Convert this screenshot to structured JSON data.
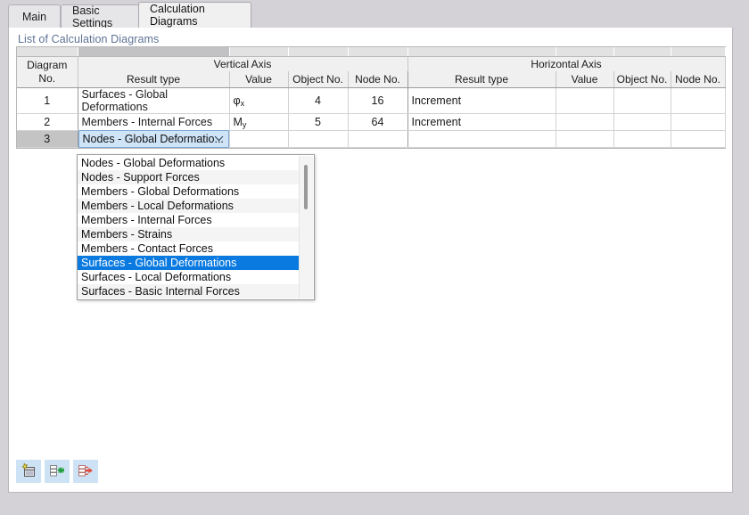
{
  "window": {
    "background_color": "#d4d2d6",
    "panel_color": "#ffffff"
  },
  "tabs": [
    {
      "label": "Main",
      "active": false
    },
    {
      "label": "Basic Settings",
      "active": false
    },
    {
      "label": "Calculation Diagrams",
      "active": true
    }
  ],
  "panel": {
    "title": "List of Calculation Diagrams",
    "title_color": "#5e7496"
  },
  "table": {
    "corner_header": {
      "line1": "Diagram",
      "line2": "No."
    },
    "groups": [
      {
        "label": "Vertical Axis"
      },
      {
        "label": "Horizontal Axis"
      }
    ],
    "columns": [
      "Result type",
      "Value",
      "Object No.",
      "Node No.",
      "Result type",
      "Value",
      "Object No.",
      "Node No."
    ],
    "rows": [
      {
        "no": "1",
        "v_result_type": "Surfaces - Global Deformations",
        "v_value": "φ",
        "v_value_sub": "x",
        "v_object_no": "4",
        "v_node_no": "16",
        "h_result_type": "Increment",
        "h_value": "",
        "h_object_no": "",
        "h_node_no": ""
      },
      {
        "no": "2",
        "v_result_type": "Members - Internal Forces",
        "v_value": "M",
        "v_value_sub": "y",
        "v_object_no": "5",
        "v_node_no": "64",
        "h_result_type": "Increment",
        "h_value": "",
        "h_object_no": "",
        "h_node_no": ""
      },
      {
        "no": "3",
        "v_result_type": "Nodes - Global Deformatio...",
        "v_value": "",
        "v_value_sub": "",
        "v_object_no": "",
        "v_node_no": "",
        "h_result_type": "",
        "h_value": "",
        "h_object_no": "",
        "h_node_no": ""
      }
    ],
    "editing_row_index": 2
  },
  "dropdown": {
    "open": true,
    "selected_label": "Surfaces - Global Deformations",
    "highlight_color": "#0a7ae0",
    "items": [
      "Nodes - Global Deformations",
      "Nodes - Support Forces",
      "Members - Global Deformations",
      "Members - Local Deformations",
      "Members - Internal Forces",
      "Members - Strains",
      "Members - Contact Forces",
      "Surfaces - Global Deformations",
      "Surfaces - Local Deformations",
      "Surfaces - Basic Internal Forces"
    ]
  },
  "toolbar": {
    "buttons": [
      {
        "name": "new-diagram-button",
        "icon": "new-document-icon",
        "tooltip": "New"
      },
      {
        "name": "import-diagram-button",
        "icon": "import-arrow-icon",
        "tooltip": "Import"
      },
      {
        "name": "export-diagram-button",
        "icon": "export-arrow-icon",
        "tooltip": "Export"
      }
    ]
  }
}
